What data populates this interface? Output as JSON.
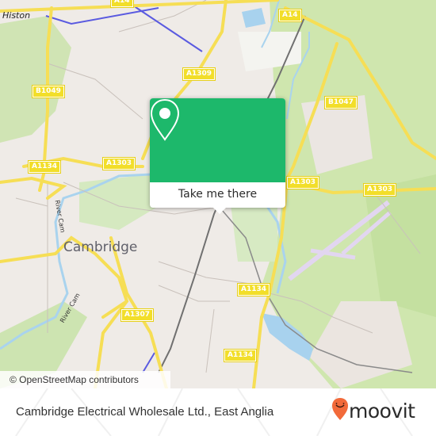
{
  "map": {
    "place_labels": {
      "histon": "Histon",
      "cambridge": "Cambridge"
    },
    "river_labels": {
      "river_cam_1": "River Cam",
      "river_cam_2": "River Cam"
    },
    "road_labels": {
      "a14_left": "A14",
      "a14_right": "A14",
      "b1049": "B1049",
      "a1309": "A1309",
      "b1047": "B1047",
      "a1134_left": "A1134",
      "a1303_left": "A1303",
      "a1303_mid": "A1303",
      "a1303_right": "A1303",
      "a1307": "A1307",
      "a1134_mid": "A1134",
      "a1134_bottom": "A1134"
    },
    "attribution": "© OpenStreetMap contributors"
  },
  "popup": {
    "icon": "location-pin-icon",
    "button_label": "Take me there",
    "accent_color": "#1db86b"
  },
  "footer": {
    "title": "Cambridge Electrical Wholesale Ltd., East Anglia",
    "logo_text": "moovit",
    "logo_color": "#f26a3a"
  }
}
